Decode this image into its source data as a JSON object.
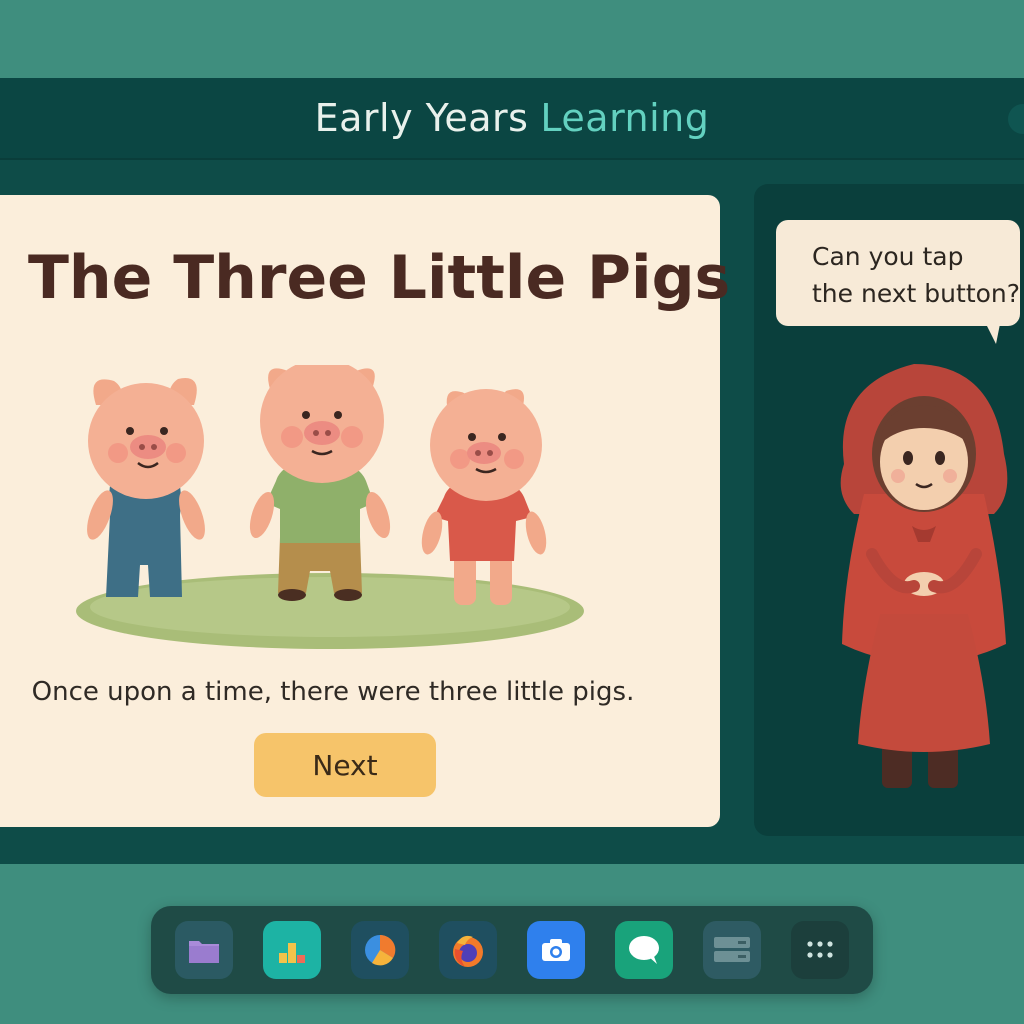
{
  "window": {
    "title_main": "Early Years",
    "title_accent": "Learning"
  },
  "story": {
    "title": "The Three Little Pigs",
    "text": "Once upon a time, there were three little pigs.",
    "next_label": "Next"
  },
  "guide": {
    "bubble_line1": "Can you tap",
    "bubble_line2": "the next button?"
  },
  "dock": {
    "items": [
      {
        "icon": "folder-icon",
        "color": "#2b5a63"
      },
      {
        "icon": "chart-app-icon",
        "color": "#1db3a4"
      },
      {
        "icon": "pie-chart-app-icon",
        "color": "#1f4f60"
      },
      {
        "icon": "firefox-icon",
        "color": "#1f4f60"
      },
      {
        "icon": "camera-icon",
        "color": "#2f80ed"
      },
      {
        "icon": "chat-icon",
        "color": "#19a37b"
      },
      {
        "icon": "server-icon",
        "color": "#2e5b63"
      },
      {
        "icon": "app-grid-icon",
        "color": "#1c3f3c"
      }
    ]
  },
  "colors": {
    "desktop": "#3f8e7e",
    "window": "#0e4c48",
    "accent": "#63d1c0",
    "card": "#fbeedb",
    "button": "#f6c46a",
    "hood": "#c84a3c"
  }
}
